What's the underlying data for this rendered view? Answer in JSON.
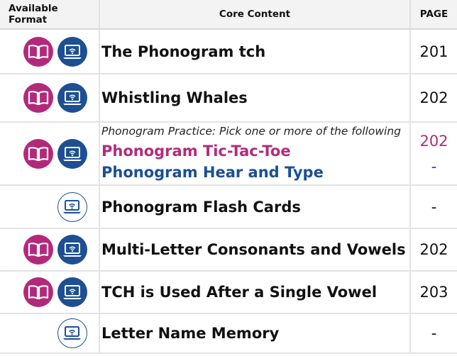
{
  "header": {
    "format_label": "Available Format",
    "content_label": "Core Content",
    "page_label": "PAGE"
  },
  "colors": {
    "print_icon": "#b3297a",
    "digital_icon": "#1d4f92",
    "pink_text": "#b32b7a",
    "blue_text": "#1b4f92"
  },
  "rows": [
    {
      "icons": [
        "book-icon",
        "laptop-icon"
      ],
      "title": "The Phonogram tch",
      "page": "201"
    },
    {
      "icons": [
        "book-icon",
        "laptop-icon"
      ],
      "title": "Whistling Whales",
      "page": "202"
    },
    {
      "icons": [
        "book-icon",
        "laptop-icon"
      ],
      "hint": "Phonogram Practice: Pick one or more of the following",
      "options": [
        {
          "title": "Phonogram Tic-Tac-Toe",
          "page": "202"
        },
        {
          "title": "Phonogram Hear and Type",
          "page": "-"
        }
      ]
    },
    {
      "icons": [
        "laptop-outline-icon"
      ],
      "title": "Phonogram Flash Cards",
      "page": "-"
    },
    {
      "icons": [
        "book-icon",
        "laptop-icon"
      ],
      "title": "Multi-Letter Consonants and Vowels",
      "page": "202"
    },
    {
      "icons": [
        "book-icon",
        "laptop-icon"
      ],
      "title": "TCH is Used After a Single Vowel",
      "page": "203"
    },
    {
      "icons": [
        "laptop-outline-icon"
      ],
      "title": "Letter Name Memory",
      "page": "-"
    }
  ]
}
